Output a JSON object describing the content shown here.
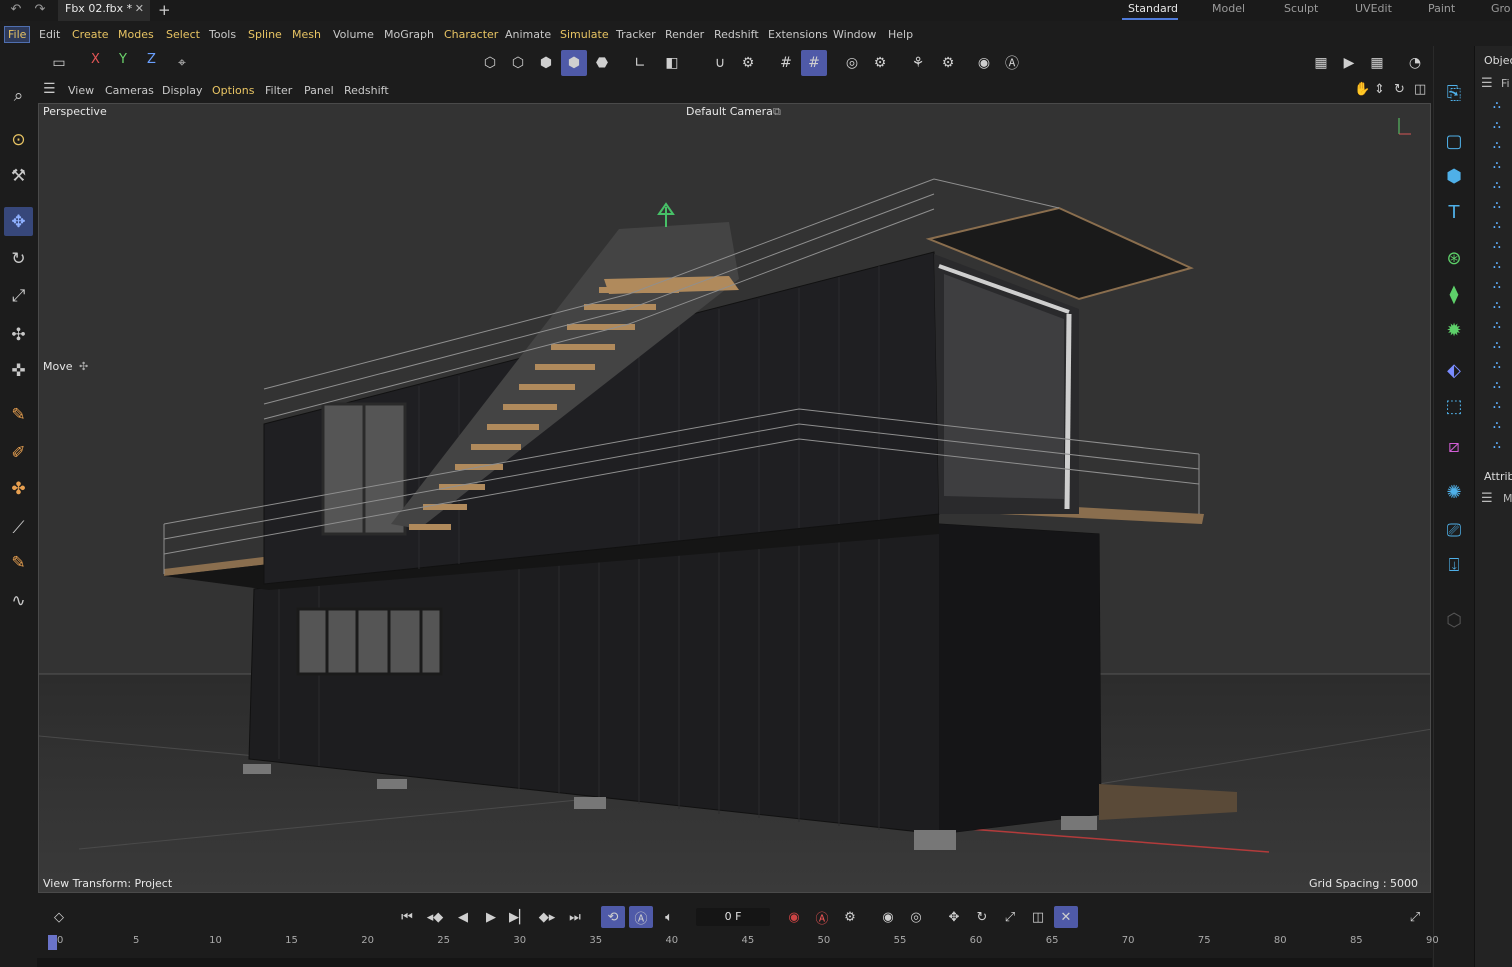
{
  "titlebar": {
    "undo_icon": "undo-icon",
    "redo_icon": "redo-icon",
    "document_tab": "Fbx 02.fbx *",
    "layouts": [
      "Standard",
      "Model",
      "Sculpt",
      "UVEdit",
      "Paint",
      "Gro"
    ]
  },
  "menu": [
    "File",
    "Edit",
    "Create",
    "Modes",
    "Select",
    "Tools",
    "Spline",
    "Mesh",
    "Volume",
    "MoGraph",
    "Character",
    "Animate",
    "Simulate",
    "Tracker",
    "Render",
    "Redshift",
    "Extensions",
    "Window",
    "Help"
  ],
  "toolbar": {
    "axis_x": "X",
    "axis_y": "Y",
    "axis_z": "Z"
  },
  "viewport_menu": [
    "View",
    "Cameras",
    "Display",
    "Options",
    "Filter",
    "Panel",
    "Redshift"
  ],
  "viewport": {
    "view_name": "Perspective",
    "camera": "Default Camera",
    "tool_label": "Move",
    "view_transform": "View Transform: Project",
    "grid_spacing": "Grid Spacing : 5000 cm"
  },
  "object_panel": {
    "title": "Objec",
    "rows": 18
  },
  "attributes": {
    "title": "Attrib"
  },
  "timeline": {
    "current_frame": "0 F",
    "ruler_ticks": [
      "0",
      "5",
      "10",
      "15",
      "20",
      "25",
      "30",
      "35",
      "40",
      "45",
      "50",
      "55",
      "60",
      "65",
      "70",
      "75",
      "80",
      "85",
      "90"
    ]
  },
  "colors": {
    "accent": "#4f5aa8",
    "menu_highlight": "#e8c463",
    "viewport_bg": "#333333",
    "icon_blue": "#4fb0e8",
    "icon_green": "#5ed16a"
  }
}
